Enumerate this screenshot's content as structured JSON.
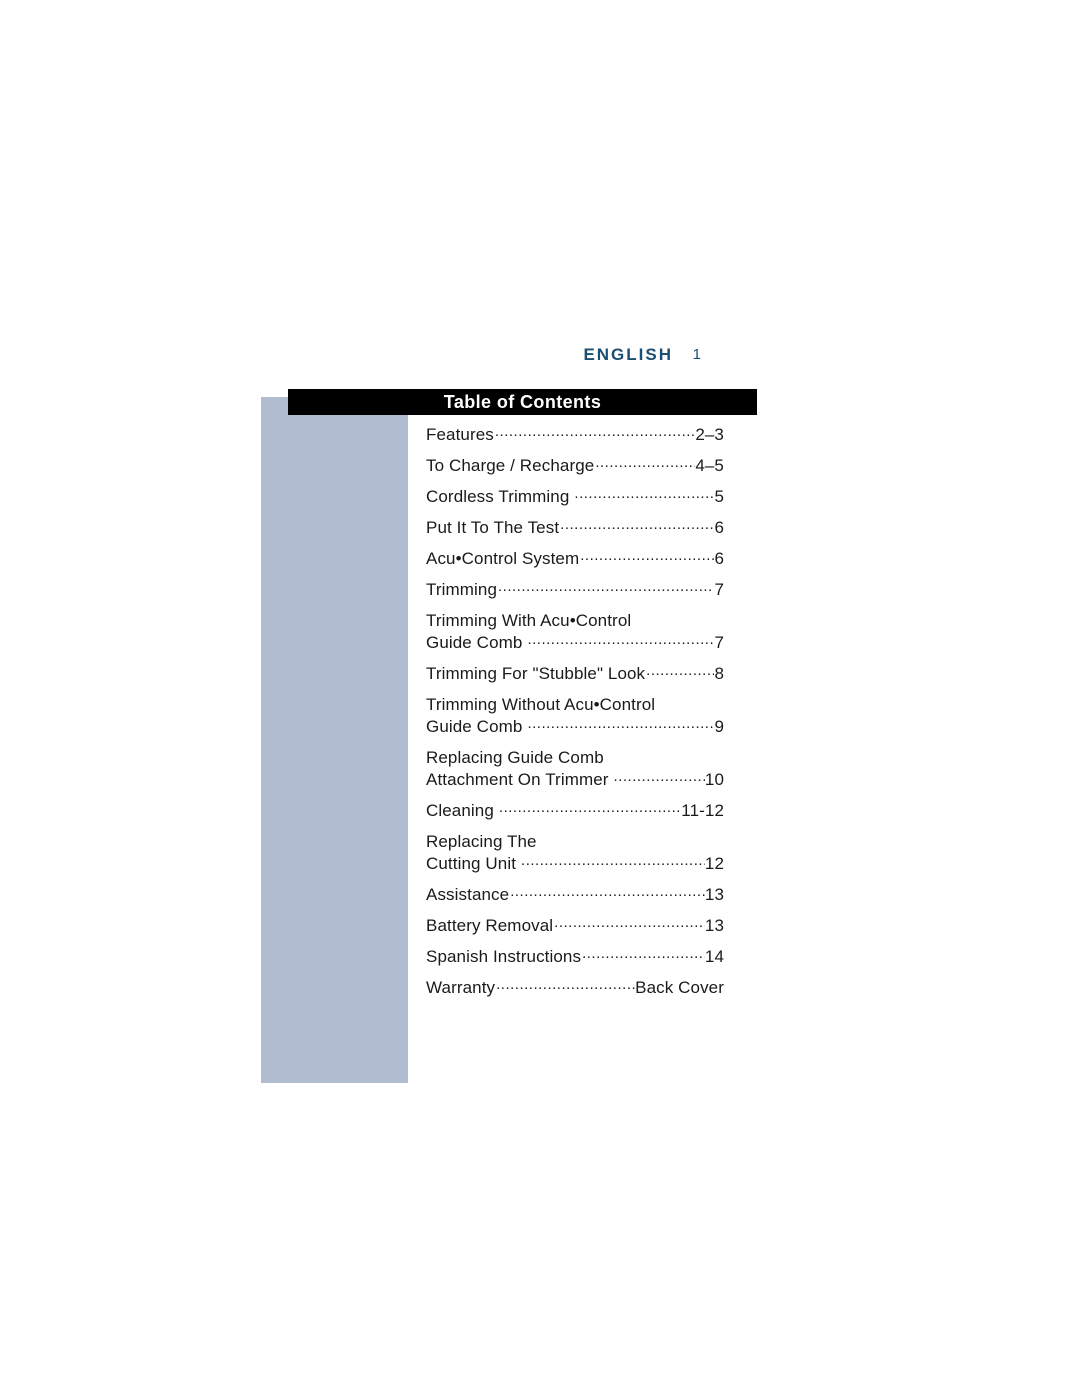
{
  "page": {
    "language_label": "ENGLISH",
    "page_number": "1",
    "accent_color": "#1a4e72",
    "panel_color": "#b0bdd0",
    "title_bar_color": "#000000"
  },
  "toc": {
    "title": "Table of Contents",
    "entries": [
      {
        "pretitle": "",
        "label": "Features",
        "page": "2–3",
        "spaced": false
      },
      {
        "pretitle": "",
        "label": "To Charge / Recharge",
        "page": "4–5",
        "spaced": false
      },
      {
        "pretitle": "",
        "label": "Cordless Trimming",
        "page": "5",
        "spaced": true
      },
      {
        "pretitle": "",
        "label": "Put It To The Test",
        "page": "6",
        "spaced": false
      },
      {
        "pretitle": "",
        "label": "Acu•Control System",
        "page": "6",
        "spaced": false
      },
      {
        "pretitle": "",
        "label": "Trimming",
        "page": "7",
        "spaced": false
      },
      {
        "pretitle": "Trimming With Acu•Control",
        "label": "Guide Comb",
        "page": "7",
        "spaced": true
      },
      {
        "pretitle": "",
        "label": "Trimming For \"Stubble\" Look",
        "page": "8",
        "spaced": false
      },
      {
        "pretitle": "Trimming Without Acu•Control",
        "label": "Guide Comb",
        "page": "9",
        "spaced": true
      },
      {
        "pretitle": "Replacing Guide Comb",
        "label": "Attachment On Trimmer",
        "page": "10",
        "spaced": true
      },
      {
        "pretitle": "",
        "label": "Cleaning",
        "page": "11-12",
        "spaced": true
      },
      {
        "pretitle": "Replacing The",
        "label": "Cutting Unit",
        "page": "12",
        "spaced": true
      },
      {
        "pretitle": "",
        "label": "Assistance",
        "page": "13",
        "spaced": false
      },
      {
        "pretitle": "",
        "label": "Battery Removal",
        "page": "13",
        "spaced": false
      },
      {
        "pretitle": "",
        "label": "Spanish Instructions",
        "page": "14",
        "spaced": false
      },
      {
        "pretitle": "",
        "label": "Warranty",
        "page": "Back Cover",
        "spaced": false
      }
    ]
  }
}
